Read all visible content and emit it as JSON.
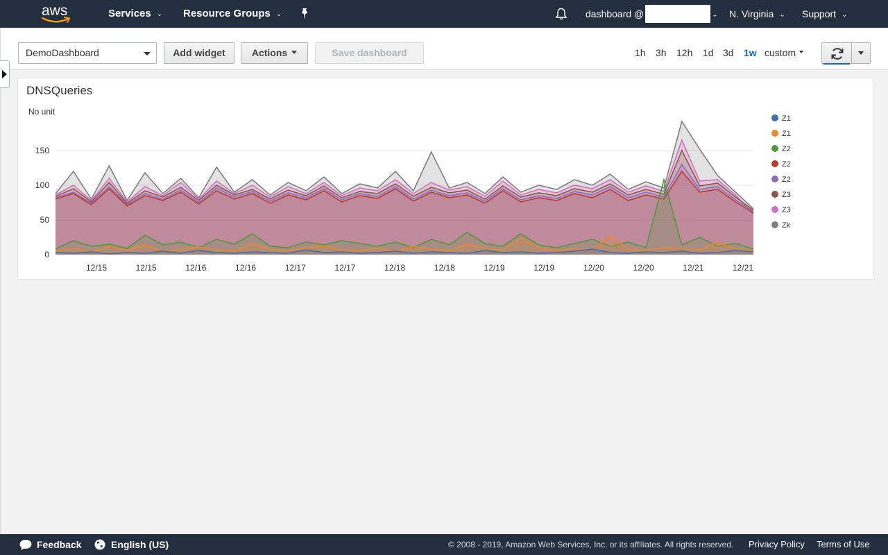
{
  "nav": {
    "logo_text": "aws",
    "services": "Services",
    "resource_groups": "Resource Groups",
    "account_label": "dashboard @",
    "region": "N. Virginia",
    "support": "Support"
  },
  "toolbar": {
    "dashboard_select": "DemoDashboard",
    "add_widget": "Add widget",
    "actions": "Actions",
    "save_dashboard": "Save dashboard",
    "time_ranges": [
      "1h",
      "3h",
      "12h",
      "1d",
      "3d",
      "1w",
      "custom"
    ],
    "active_time_range": "1w"
  },
  "widget": {
    "title": "DNSQueries"
  },
  "chart_data": {
    "type": "area",
    "title": "DNSQueries",
    "ylabel": "No unit",
    "xlabel": "",
    "ylim": [
      0,
      200
    ],
    "yticks": [
      0,
      50,
      100,
      150
    ],
    "xtick_labels": [
      "12/15",
      "12/15",
      "12/16",
      "12/16",
      "12/17",
      "12/17",
      "12/18",
      "12/18",
      "12/19",
      "12/19",
      "12/20",
      "12/20",
      "12/21",
      "12/21"
    ],
    "grid": true,
    "legend_position": "right",
    "series": [
      {
        "name": "Z1",
        "color": "#3e6fb0",
        "values": [
          3,
          2,
          4,
          1,
          3,
          2,
          5,
          2,
          6,
          3,
          2,
          4,
          3,
          2,
          7,
          3,
          4,
          2,
          3,
          5,
          2,
          4,
          3,
          2,
          6,
          3,
          4,
          2,
          3,
          5,
          8,
          3,
          2,
          4,
          3,
          5,
          2,
          3,
          6,
          4
        ]
      },
      {
        "name": "Z1",
        "color": "#e8892a",
        "values": [
          5,
          9,
          4,
          12,
          6,
          14,
          5,
          8,
          11,
          7,
          5,
          16,
          8,
          6,
          10,
          13,
          7,
          6,
          9,
          5,
          12,
          8,
          6,
          15,
          9,
          7,
          24,
          10,
          6,
          9,
          7,
          28,
          8,
          6,
          10,
          9,
          7,
          18,
          8,
          6
        ]
      },
      {
        "name": "Z2",
        "color": "#4f9a3a",
        "values": [
          8,
          20,
          12,
          15,
          9,
          28,
          14,
          18,
          10,
          22,
          15,
          30,
          12,
          10,
          18,
          14,
          20,
          16,
          12,
          18,
          10,
          22,
          14,
          32,
          16,
          12,
          30,
          14,
          10,
          16,
          22,
          12,
          18,
          10,
          108,
          14,
          25,
          12,
          16,
          8
        ]
      },
      {
        "name": "Z2",
        "color": "#c0392b",
        "values": [
          80,
          88,
          72,
          95,
          70,
          85,
          78,
          90,
          73,
          92,
          80,
          88,
          74,
          86,
          79,
          92,
          76,
          85,
          81,
          95,
          77,
          90,
          82,
          86,
          74,
          92,
          76,
          82,
          78,
          88,
          82,
          94,
          78,
          86,
          80,
          120,
          90,
          94,
          76,
          60
        ]
      },
      {
        "name": "Z2",
        "color": "#8e6bbf",
        "values": [
          82,
          90,
          74,
          98,
          72,
          88,
          80,
          93,
          75,
          96,
          83,
          91,
          77,
          89,
          82,
          95,
          79,
          88,
          84,
          98,
          80,
          93,
          85,
          89,
          77,
          95,
          79,
          85,
          81,
          91,
          86,
          98,
          82,
          90,
          83,
          130,
          94,
          98,
          79,
          62
        ]
      },
      {
        "name": "Z3",
        "color": "#8c564b",
        "values": [
          84,
          95,
          76,
          104,
          74,
          92,
          83,
          97,
          78,
          100,
          86,
          94,
          80,
          93,
          85,
          99,
          82,
          91,
          88,
          102,
          84,
          97,
          89,
          93,
          80,
          99,
          83,
          89,
          85,
          95,
          90,
          102,
          86,
          94,
          87,
          150,
          99,
          103,
          83,
          64
        ]
      },
      {
        "name": "Z3",
        "color": "#d46ec0",
        "values": [
          86,
          100,
          78,
          110,
          76,
          98,
          85,
          104,
          80,
          106,
          88,
          100,
          83,
          98,
          88,
          104,
          85,
          96,
          92,
          108,
          88,
          104,
          93,
          98,
          84,
          106,
          86,
          94,
          89,
          100,
          95,
          108,
          90,
          99,
          91,
          165,
          106,
          108,
          86,
          58
        ]
      },
      {
        "name": "Zk",
        "color": "#808080",
        "values": [
          88,
          120,
          80,
          128,
          78,
          118,
          88,
          110,
          82,
          126,
          90,
          108,
          86,
          104,
          92,
          112,
          88,
          102,
          96,
          120,
          92,
          148,
          96,
          104,
          88,
          112,
          90,
          100,
          94,
          108,
          100,
          116,
          94,
          105,
          96,
          192,
          152,
          114,
          90,
          66
        ]
      }
    ]
  },
  "footer": {
    "feedback": "Feedback",
    "language": "English (US)",
    "copyright": "© 2008 - 2019, Amazon Web Services, Inc. or its affiliates. All rights reserved.",
    "privacy": "Privacy Policy",
    "terms": "Terms of Use"
  }
}
